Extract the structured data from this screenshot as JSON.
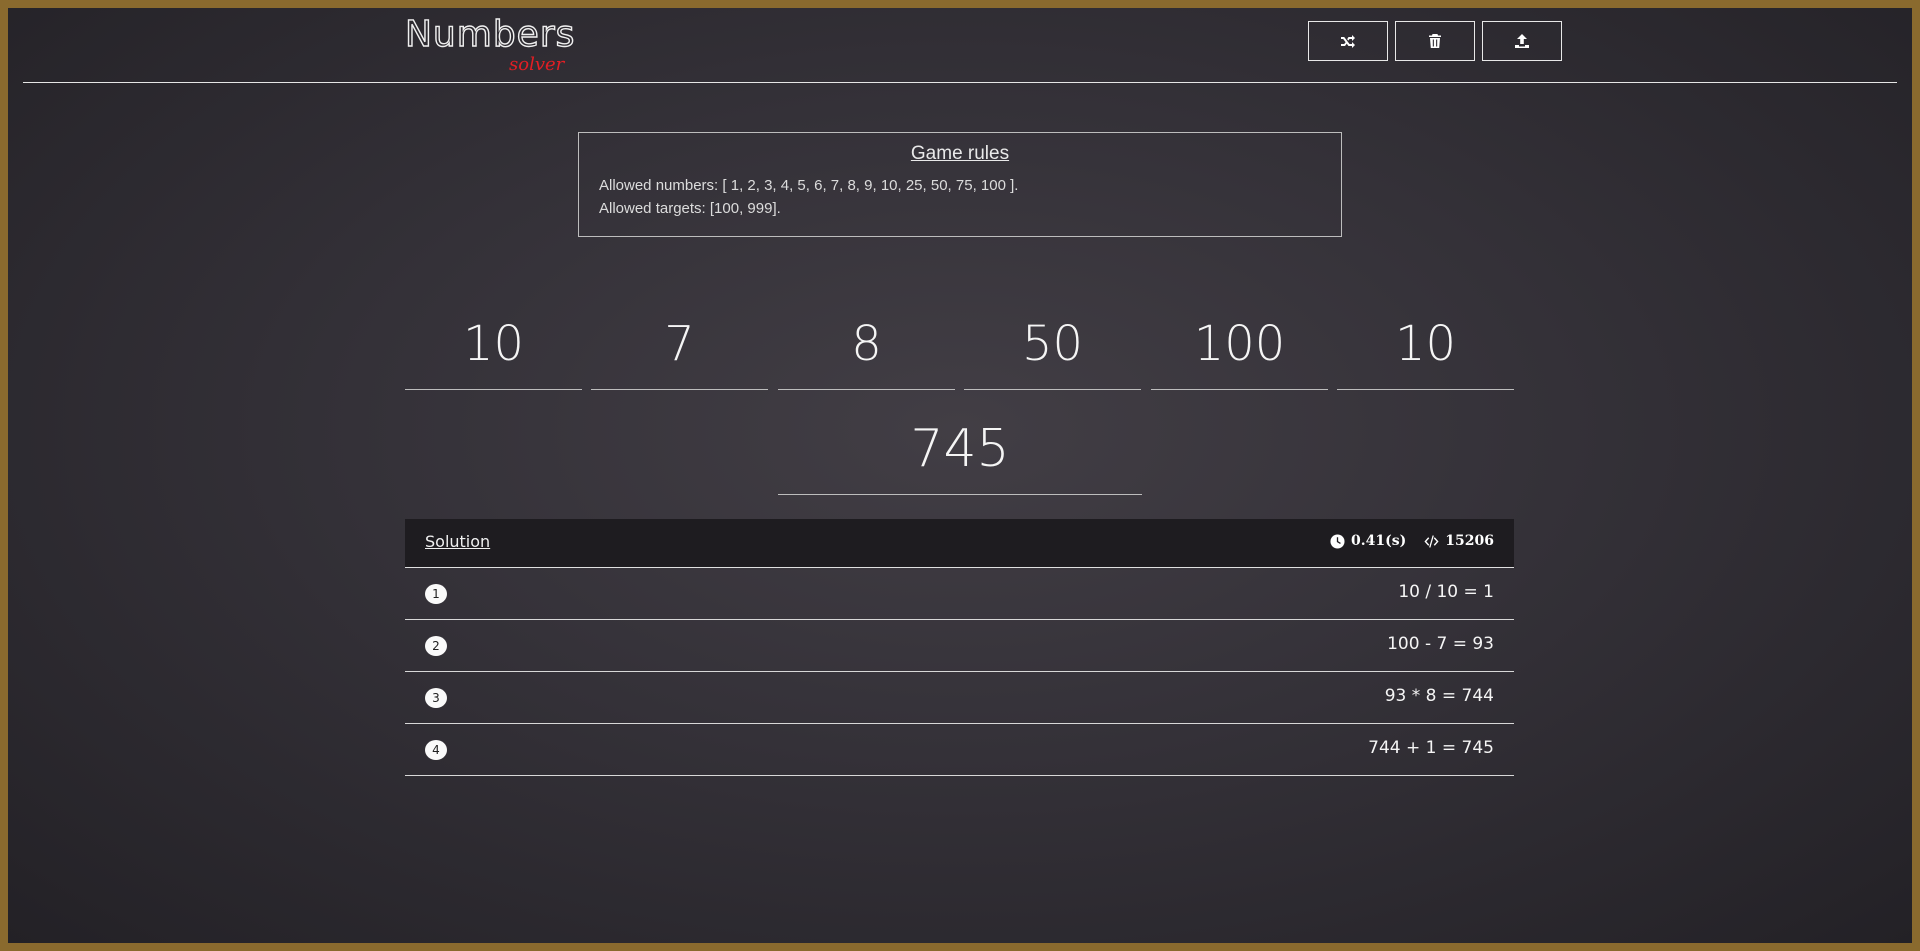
{
  "header": {
    "logo_main": "Numbers",
    "logo_sub": "solver",
    "buttons": [
      {
        "name": "shuffle",
        "icon": "shuffle-icon"
      },
      {
        "name": "clear",
        "icon": "trash-icon"
      },
      {
        "name": "upload",
        "icon": "upload-icon"
      }
    ]
  },
  "rules": {
    "title": "Game rules",
    "allowed_numbers": "Allowed numbers: [ 1, 2, 3, 4, 5, 6, 7, 8, 9, 10, 25, 50, 75, 100 ].",
    "allowed_targets": "Allowed targets: [100, 999]."
  },
  "numbers": [
    "10",
    "7",
    "8",
    "50",
    "100",
    "10"
  ],
  "target": "745",
  "solution": {
    "title": "Solution",
    "time": "0.41(s)",
    "iterations": "15206",
    "steps": [
      {
        "index": "1",
        "expr": "10 / 10 = 1"
      },
      {
        "index": "2",
        "expr": "100 - 7 = 93"
      },
      {
        "index": "3",
        "expr": "93 * 8 = 744"
      },
      {
        "index": "4",
        "expr": "744 + 1 = 745"
      }
    ]
  },
  "colors": {
    "border": "#8a6a2e",
    "logo_sub": "#e31e24",
    "header_band": "#1e1c20"
  }
}
